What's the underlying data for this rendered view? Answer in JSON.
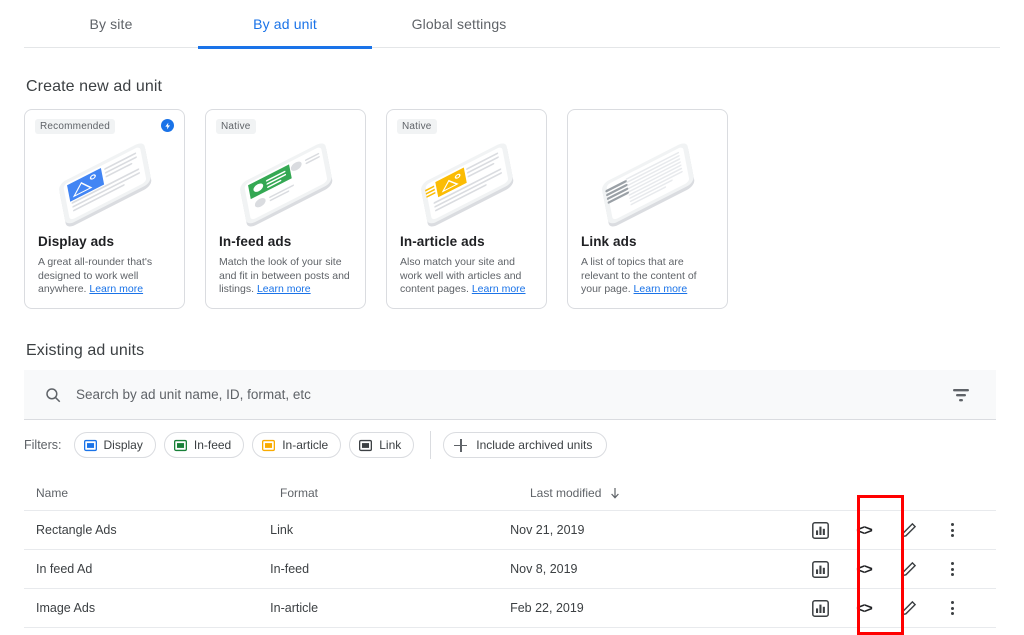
{
  "tabs": [
    {
      "label": "By site",
      "active": false
    },
    {
      "label": "By ad unit",
      "active": true
    },
    {
      "label": "Global settings",
      "active": false
    }
  ],
  "sections": {
    "create_title": "Create new ad unit",
    "existing_title": "Existing ad units"
  },
  "cards": [
    {
      "badge": "Recommended",
      "has_bolt": true,
      "bolt_icon": "bolt-icon",
      "illustration": "display-ad-phone-illustration",
      "accent": "#4285f4",
      "title": "Display ads",
      "desc": "A great all-rounder that's designed to work well anywhere.",
      "link": "Learn more"
    },
    {
      "badge": "Native",
      "has_bolt": false,
      "illustration": "in-feed-ad-phone-illustration",
      "accent": "#34a853",
      "title": "In-feed ads",
      "desc": "Match the look of your site and fit in between posts and listings.",
      "link": "Learn more"
    },
    {
      "badge": "Native",
      "has_bolt": false,
      "illustration": "in-article-ad-phone-illustration",
      "accent": "#fbbc04",
      "title": "In-article ads",
      "desc": "Also match your site and work well with articles and content pages.",
      "link": "Learn more"
    },
    {
      "badge": "",
      "has_bolt": false,
      "illustration": "link-ad-phone-illustration",
      "accent": "#9aa0a6",
      "title": "Link ads",
      "desc": "A list of topics that are relevant to the content of your page.",
      "link": "Learn more"
    }
  ],
  "search": {
    "icon": "search-icon",
    "placeholder": "Search by ad unit name, ID, format, etc",
    "value": "",
    "filter_icon": "filter-list-icon"
  },
  "filters": {
    "label": "Filters:",
    "chips": [
      {
        "label": "Display",
        "icon": "display-format-icon",
        "color": "#1a73e8"
      },
      {
        "label": "In-feed",
        "icon": "in-feed-format-icon",
        "color": "#188038"
      },
      {
        "label": "In-article",
        "icon": "in-article-format-icon",
        "color": "#f9ab00"
      },
      {
        "label": "Link",
        "icon": "link-format-icon",
        "color": "#3c4043"
      }
    ],
    "archived_button": "Include archived units",
    "archived_icon": "plus-icon"
  },
  "table": {
    "columns": [
      "Name",
      "Format",
      "Last modified"
    ],
    "sort_column": "Last modified",
    "sort_direction": "descending",
    "sort_icon": "arrow-down-icon",
    "row_actions": [
      "stats-icon",
      "code-icon",
      "edit-pencil-icon",
      "more-vert-icon"
    ],
    "code_glyph": "<>",
    "rows": [
      {
        "name": "Rectangle Ads",
        "format": "Link",
        "modified": "Nov 21, 2019"
      },
      {
        "name": "In feed Ad",
        "format": "In-feed",
        "modified": "Nov 8, 2019"
      },
      {
        "name": "Image Ads",
        "format": "In-article",
        "modified": "Feb 22, 2019"
      }
    ]
  },
  "annotation": {
    "name": "code-column-highlight",
    "color": "#ff0000"
  },
  "colors": {
    "accent_blue": "#1a73e8",
    "text_primary": "#3c4043",
    "text_secondary": "#5f6368",
    "border": "#dadce0",
    "search_bg": "#f8f9fa"
  }
}
